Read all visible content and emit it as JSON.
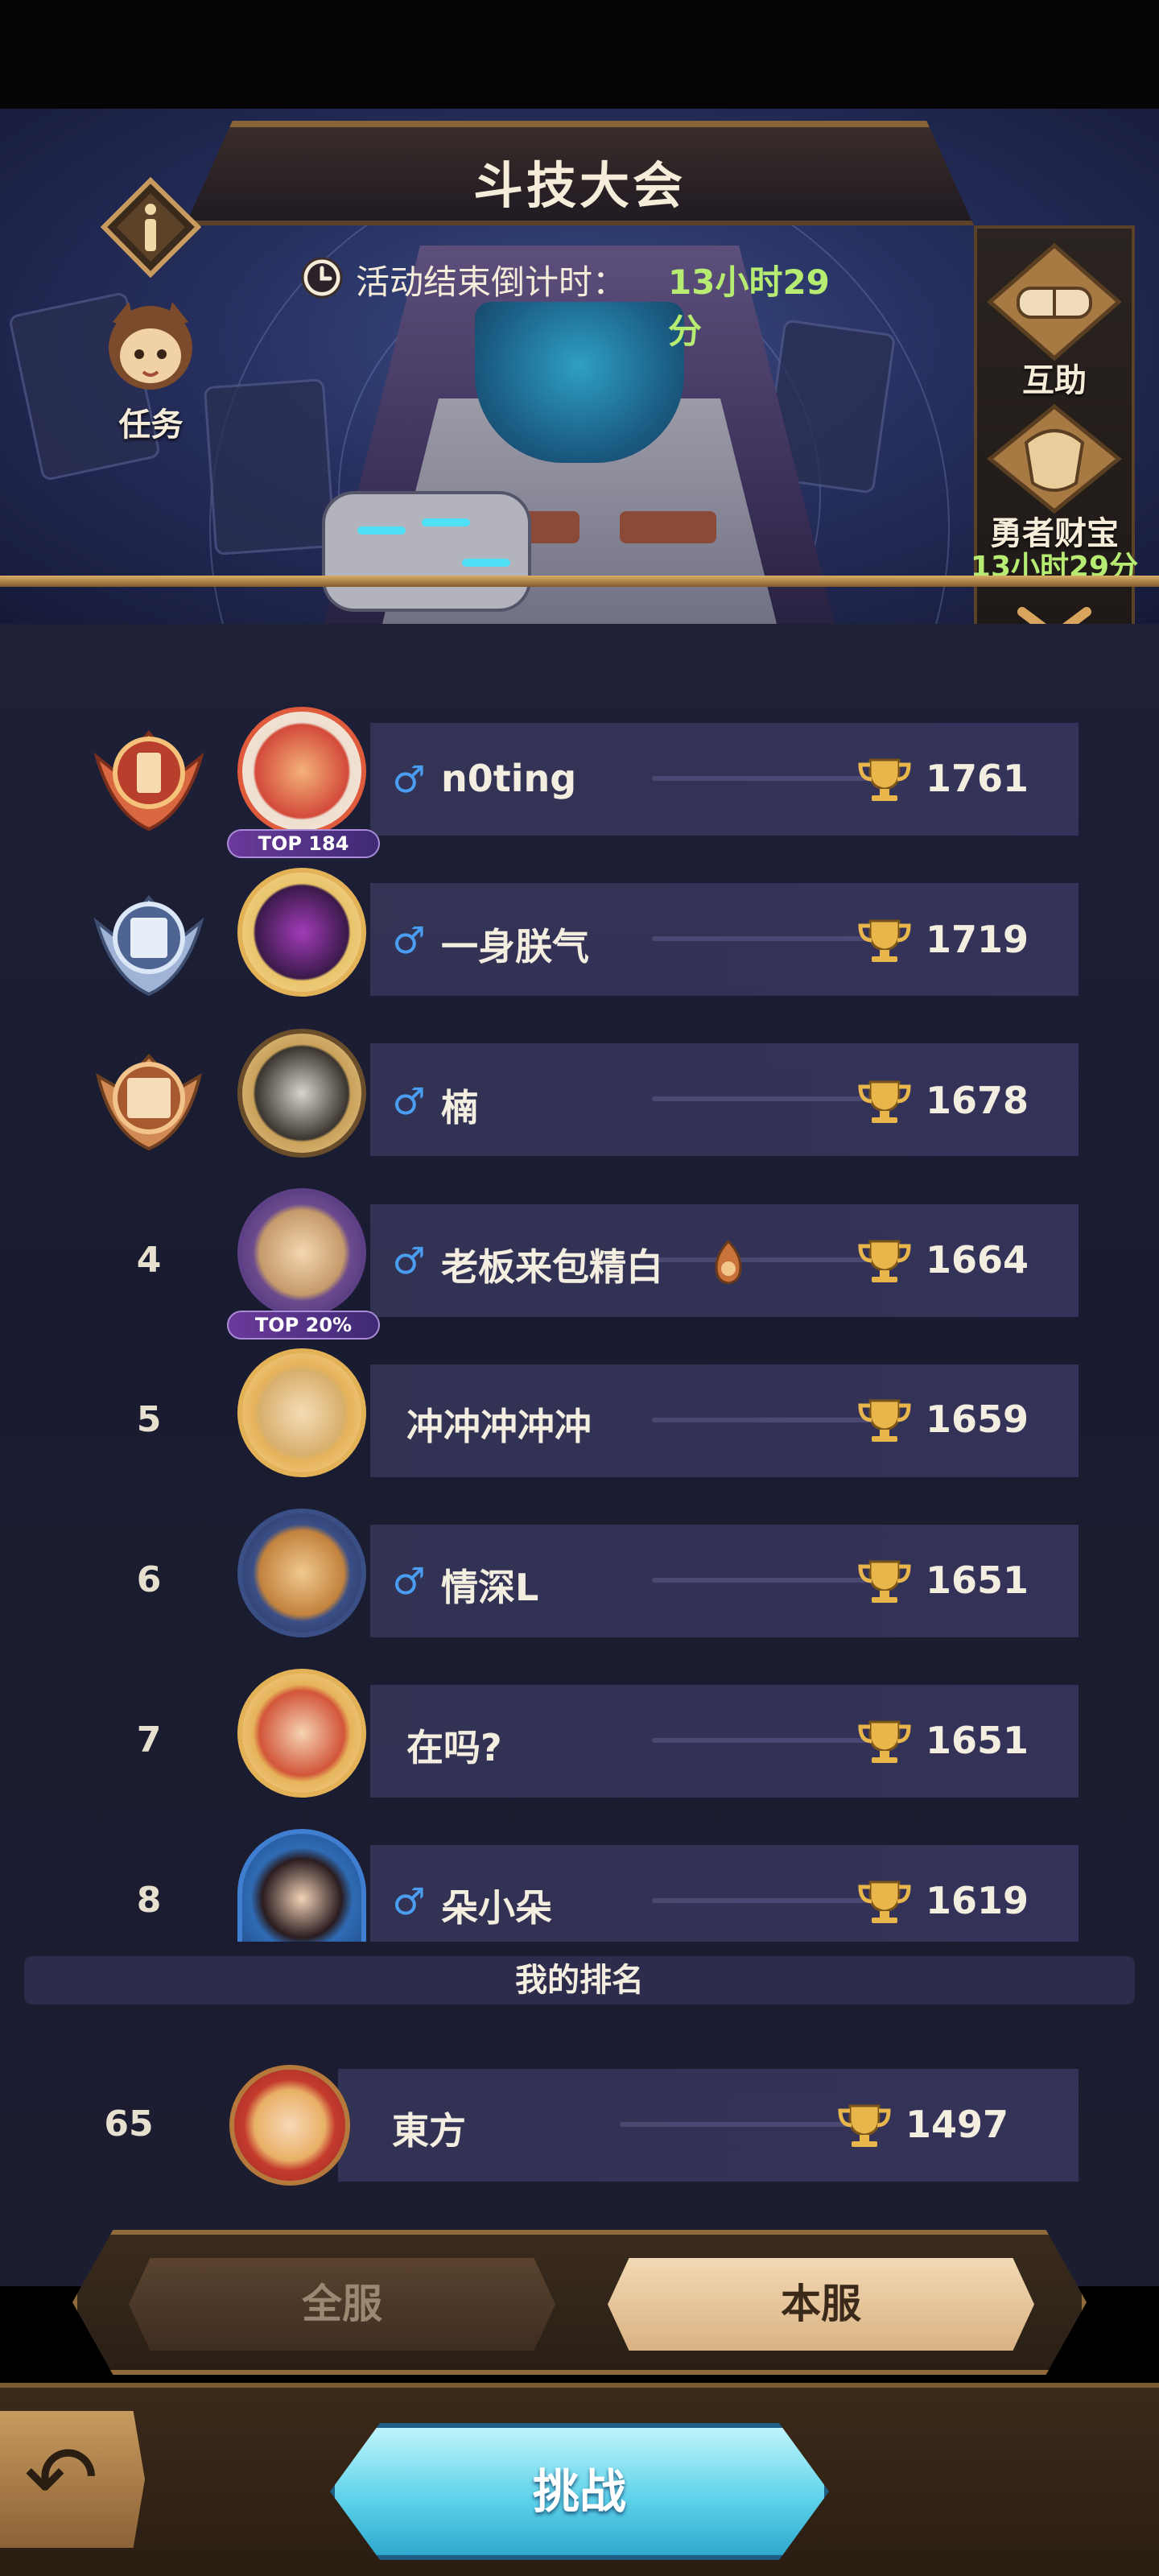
{
  "header": {
    "title": "斗技大会",
    "countdown_label": "活动结束倒计时：",
    "countdown_value": "13小时29分"
  },
  "left_buttons": {
    "task_label": "任务"
  },
  "side_panel": {
    "assist_label": "互助",
    "treasure_label": "勇者财宝",
    "treasure_timer": "13小时29分"
  },
  "leaderboard": [
    {
      "rank": "1",
      "name": "n0ting",
      "score": "1761",
      "gender": "♂",
      "tag": "TOP 184"
    },
    {
      "rank": "2",
      "name": "一身朕气",
      "score": "1719",
      "gender": "♂"
    },
    {
      "rank": "3",
      "name": "楠",
      "score": "1678",
      "gender": "♂"
    },
    {
      "rank": "4",
      "name": "老板来包精白",
      "score": "1664",
      "gender": "♂",
      "tag": "TOP 20%"
    },
    {
      "rank": "5",
      "name": "冲冲冲冲冲",
      "score": "1659"
    },
    {
      "rank": "6",
      "name": "情深L",
      "score": "1651",
      "gender": "♂"
    },
    {
      "rank": "7",
      "name": "在吗?",
      "score": "1651"
    },
    {
      "rank": "8",
      "name": "朵小朵",
      "score": "1619",
      "gender": "♂"
    }
  ],
  "my_rank": {
    "header": "我的排名",
    "rank": "65",
    "name": "東方",
    "score": "1497"
  },
  "tabs": {
    "all_server": "全服",
    "this_server": "本服",
    "active": "本服"
  },
  "actions": {
    "challenge": "挑战"
  },
  "colors": {
    "timer_green": "#b7ec72",
    "gender_blue": "#4a9df0",
    "gold": "#e8b64a"
  }
}
